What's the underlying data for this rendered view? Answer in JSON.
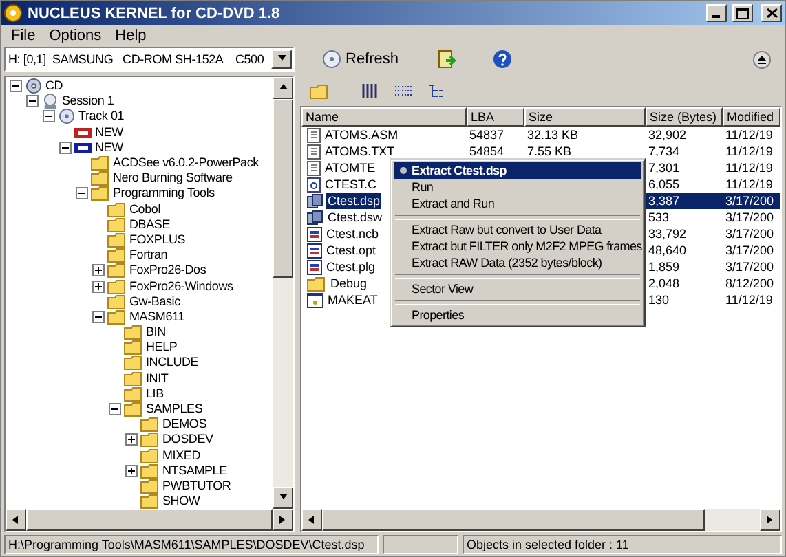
{
  "window": {
    "title": "NUCLEUS KERNEL for CD-DVD 1.8"
  },
  "menu": [
    "File",
    "Options",
    "Help"
  ],
  "toolbar": {
    "drive": "H: [0,1]  SAMSUNG   CD-ROM SH-152A    C500",
    "refresh": "Refresh"
  },
  "tree": [
    {
      "label": "CD",
      "kind": "disc",
      "expanded": true,
      "children": [
        {
          "label": "Session 1",
          "kind": "session",
          "expanded": true,
          "children": [
            {
              "label": "Track 01",
              "kind": "track",
              "expanded": true,
              "children": [
                {
                  "label": "NEW",
                  "kind": "audio"
                },
                {
                  "label": "NEW",
                  "kind": "data",
                  "expanded": true,
                  "children": [
                    {
                      "label": "ACDSee v6.0.2-PowerPack",
                      "kind": "folder"
                    },
                    {
                      "label": "Nero Burning Software",
                      "kind": "folder"
                    },
                    {
                      "label": "Programming Tools",
                      "kind": "folder",
                      "expanded": true,
                      "children": [
                        {
                          "label": "Cobol",
                          "kind": "folder"
                        },
                        {
                          "label": "DBASE",
                          "kind": "folder"
                        },
                        {
                          "label": "FOXPLUS",
                          "kind": "folder"
                        },
                        {
                          "label": "Fortran",
                          "kind": "folder"
                        },
                        {
                          "label": "FoxPro26-Dos",
                          "kind": "folder",
                          "expanded": false
                        },
                        {
                          "label": "FoxPro26-Windows",
                          "kind": "folder",
                          "expanded": false
                        },
                        {
                          "label": "Gw-Basic",
                          "kind": "folder"
                        },
                        {
                          "label": "MASM611",
                          "kind": "folder",
                          "expanded": true,
                          "children": [
                            {
                              "label": "BIN",
                              "kind": "folder"
                            },
                            {
                              "label": "HELP",
                              "kind": "folder"
                            },
                            {
                              "label": "INCLUDE",
                              "kind": "folder"
                            },
                            {
                              "label": "INIT",
                              "kind": "folder"
                            },
                            {
                              "label": "LIB",
                              "kind": "folder"
                            },
                            {
                              "label": "SAMPLES",
                              "kind": "folder",
                              "expanded": true,
                              "children": [
                                {
                                  "label": "DEMOS",
                                  "kind": "folder"
                                },
                                {
                                  "label": "DOSDEV",
                                  "kind": "folder",
                                  "expanded": false
                                },
                                {
                                  "label": "MIXED",
                                  "kind": "folder"
                                },
                                {
                                  "label": "NTSAMPLE",
                                  "kind": "folder",
                                  "expanded": false
                                },
                                {
                                  "label": "PWBTUTOR",
                                  "kind": "folder"
                                },
                                {
                                  "label": "SHOW",
                                  "kind": "folder"
                                }
                              ]
                            }
                          ]
                        }
                      ]
                    }
                  ]
                }
              ]
            }
          ]
        }
      ]
    }
  ],
  "list": {
    "columns": [
      "Name",
      "LBA",
      "Size",
      "Size (Bytes)",
      "Modified"
    ],
    "rows": [
      {
        "kind": "text",
        "name": "ATOMS.ASM",
        "lba": "54837",
        "size": "32.13 KB",
        "size_bytes": "32,902",
        "modified": "11/12/19",
        "selected": false
      },
      {
        "kind": "text",
        "name": "ATOMS.TXT",
        "lba": "54854",
        "size": "7.55 KB",
        "size_bytes": "7,734",
        "modified": "11/12/19",
        "selected": false
      },
      {
        "kind": "text",
        "name": "ATOMTE",
        "size_bytes": "7,301",
        "modified": "11/12/19",
        "selected": false
      },
      {
        "kind": "source",
        "name": "CTEST.C",
        "size_bytes": "6,055",
        "modified": "11/12/19",
        "selected": false
      },
      {
        "kind": "project",
        "name": "Ctest.dsp",
        "size_bytes": "3,387",
        "modified": "3/17/200",
        "selected": true
      },
      {
        "kind": "project",
        "name": "Ctest.dsw",
        "size_bytes": "533",
        "modified": "3/17/200",
        "selected": false
      },
      {
        "kind": "data",
        "name": "Ctest.ncb",
        "size_bytes": "33,792",
        "modified": "3/17/200",
        "selected": false
      },
      {
        "kind": "data",
        "name": "Ctest.opt",
        "size_bytes": "48,640",
        "modified": "3/17/200",
        "selected": false
      },
      {
        "kind": "data",
        "name": "Ctest.plg",
        "size_bytes": "1,859",
        "modified": "3/17/200",
        "selected": false
      },
      {
        "kind": "folder",
        "name": "Debug",
        "size_bytes": "2,048",
        "modified": "8/12/200",
        "selected": false
      },
      {
        "kind": "program",
        "name": "MAKEAT",
        "size_bytes": "130",
        "modified": "11/12/19",
        "selected": false
      }
    ]
  },
  "context_menu": [
    {
      "kind": "header",
      "label": "Extract Ctest.dsp",
      "selected": true
    },
    {
      "kind": "item",
      "label": "Run",
      "selected": false
    },
    {
      "kind": "item",
      "label": "Extract and Run",
      "selected": false
    },
    {
      "kind": "separator"
    },
    {
      "kind": "item",
      "label": "Extract Raw but convert to User Data",
      "selected": false
    },
    {
      "kind": "item",
      "label": "Extract but FILTER only M2F2 MPEG frames",
      "selected": false
    },
    {
      "kind": "item",
      "label": "Extract RAW Data (2352 bytes/block)",
      "selected": false
    },
    {
      "kind": "separator"
    },
    {
      "kind": "item",
      "label": "Sector View",
      "selected": false
    },
    {
      "kind": "separator"
    },
    {
      "kind": "item",
      "label": "Properties",
      "selected": false
    }
  ],
  "status_bar": {
    "path": "H:\\Programming Tools\\MASM611\\SAMPLES\\DOSDEV\\Ctest.dsp",
    "objects": "Objects in selected folder : 11"
  }
}
